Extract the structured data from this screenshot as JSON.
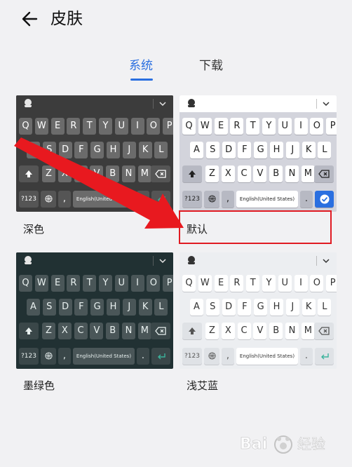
{
  "header": {
    "title": "皮肤"
  },
  "tabs": [
    {
      "label": "系统",
      "active": true
    },
    {
      "label": "下载",
      "active": false
    }
  ],
  "keyboard": {
    "row1": [
      "Q",
      "W",
      "E",
      "R",
      "T",
      "Y",
      "U",
      "I",
      "O",
      "P"
    ],
    "row2": [
      "A",
      "S",
      "D",
      "F",
      "G",
      "H",
      "J",
      "K",
      "L"
    ],
    "row3": [
      "Z",
      "X",
      "C",
      "V",
      "B",
      "N",
      "M"
    ],
    "num_key": "?123",
    "comma_key": ",",
    "period_key": ".",
    "space_label": "English(United States)"
  },
  "skins": [
    {
      "name": "深色",
      "theme": "dark"
    },
    {
      "name": "默认",
      "theme": "default",
      "highlighted": true
    },
    {
      "name": "墨绿色",
      "theme": "green"
    },
    {
      "name": "浅艾蓝",
      "theme": "light"
    }
  ],
  "colors": {
    "accent": "#2a6fe0",
    "annotation": "#e01b22"
  },
  "watermark": {
    "text": "Bai 经验"
  }
}
